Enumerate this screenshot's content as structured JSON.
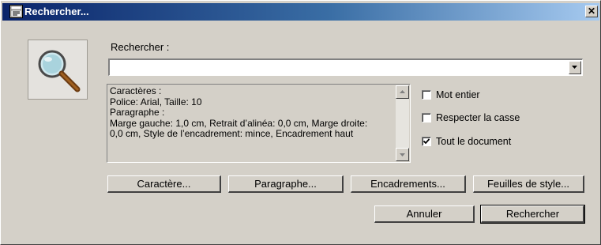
{
  "window": {
    "title": "Rechercher..."
  },
  "search": {
    "label": "Rechercher :",
    "value": ""
  },
  "description": {
    "lines": [
      "Caractères :",
      "Police: Arial, Taille: 10",
      "Paragraphe :",
      "Marge gauche: 1,0 cm, Retrait d’alinéa: 0,0 cm, Marge droite:",
      "0,0 cm, Style de l’encadrement: mince, Encadrement haut"
    ]
  },
  "options": {
    "mot_entier": {
      "label": "Mot entier",
      "checked": false
    },
    "respecter_casse": {
      "label": "Respecter la casse",
      "checked": false
    },
    "tout_document": {
      "label": "Tout le document",
      "checked": true
    }
  },
  "buttons": {
    "caractere": "Caractère...",
    "paragraphe": "Paragraphe...",
    "encadrements": "Encadrements...",
    "feuilles_style": "Feuilles de style...",
    "annuler": "Annuler",
    "rechercher": "Rechercher"
  },
  "icons": {
    "title": "document-icon",
    "close": "close-icon",
    "search": "magnifier-icon",
    "dropdown": "chevron-down-icon"
  }
}
